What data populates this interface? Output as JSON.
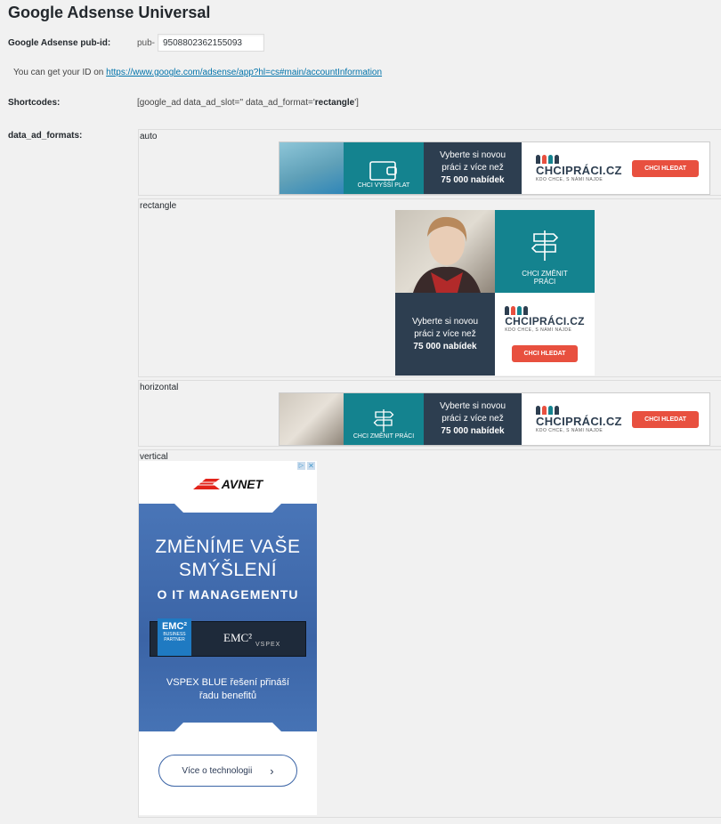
{
  "page": {
    "title": "Google Adsense Universal",
    "pubid_label": "Google Adsense pub-id:",
    "pubid_prefix": "pub-",
    "pubid_value": "9508802362155093",
    "getid_text": "You can get your ID on",
    "getid_link": "https://www.google.com/adsense/app?hl=cs#main/accountInformation",
    "shortcodes_label": "Shortcodes:",
    "shortcode_pre": "[google_ad data_ad_slot='' data_ad_format='",
    "shortcode_bold": "rectangle",
    "shortcode_post": "']",
    "formats_label": "data_ad_formats:"
  },
  "formats": [
    {
      "name": "auto"
    },
    {
      "name": "rectangle"
    },
    {
      "name": "horizontal"
    },
    {
      "name": "vertical"
    }
  ],
  "ad_chci": {
    "teal_auto": "CHCI VYŠŠÍ PLAT",
    "teal_change": "CHCI ZMĚNIT PRÁCI",
    "teal_change_l1": "CHCI ZMĚNIT",
    "teal_change_l2": "PRÁCI",
    "navy_l1": "Vyberte si novou",
    "navy_l2": "práci z více než",
    "navy_l3": "75 000 nabídek",
    "logo": "CHCIPRÁCI.CZ",
    "logo_sub": "KDO CHCE, S NÁMI NAJDE",
    "button": "CHCI HLEDAT",
    "colors": {
      "teal": "#14838f",
      "navy": "#2d3e50",
      "red": "#e8503f"
    }
  },
  "ad_avnet": {
    "brand": "AVNET",
    "head_l1": "ZMĚNÍME VAŠE",
    "head_l2": "SMÝŠLENÍ",
    "sub": "O IT MANAGEMENTU",
    "emc": "EMC²",
    "emc_sub1": "BUSINESS",
    "emc_sub2": "PARTNER",
    "vspex": "VSPEX",
    "desc_l1": "VSPEX BLUE řešení přináší",
    "desc_l2": "řadu benefitů",
    "cta": "Více o technologii",
    "colors": {
      "blue": "#3b64a6",
      "red": "#e2231a"
    }
  }
}
